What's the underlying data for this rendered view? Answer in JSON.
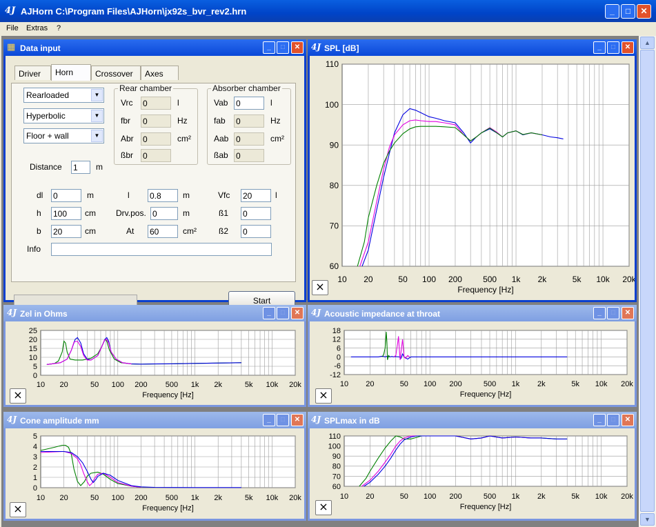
{
  "app": {
    "title": "AJHorn  C:\\Program Files\\AJHorn\\jx92s_bvr_rev2.hrn",
    "icon": "4J"
  },
  "menu": [
    "File",
    "Extras",
    "?"
  ],
  "data_input": {
    "title": "Data input",
    "tabs": [
      "Driver",
      "Horn",
      "Crossover",
      "Axes"
    ],
    "selects": [
      "Rearloaded",
      "Hyperbolic",
      "Floor + wall"
    ],
    "distance": {
      "label": "Distance",
      "value": "1",
      "unit": "m"
    },
    "rear": {
      "title": "Rear chamber",
      "rows": [
        {
          "label": "Vrc",
          "value": "0",
          "unit": "l"
        },
        {
          "label": "fbr",
          "value": "0",
          "unit": "Hz"
        },
        {
          "label": "Abr",
          "value": "0",
          "unit": "cm²"
        },
        {
          "label": "ßbr",
          "value": "0",
          "unit": ""
        }
      ]
    },
    "absorber": {
      "title": "Absorber chamber",
      "rows": [
        {
          "label": "Vab",
          "value": "0",
          "unit": "l"
        },
        {
          "label": "fab",
          "value": "0",
          "unit": "Hz"
        },
        {
          "label": "Aab",
          "value": "0",
          "unit": "cm²"
        },
        {
          "label": "ßab",
          "value": "0",
          "unit": ""
        }
      ]
    },
    "params": [
      {
        "label": "dl",
        "value": "0",
        "unit": "m"
      },
      {
        "label": "l",
        "value": "0.8",
        "unit": "m"
      },
      {
        "label": "Vfc",
        "value": "20",
        "unit": "l"
      },
      {
        "label": "h",
        "value": "100",
        "unit": "cm"
      },
      {
        "label": "Drv.pos.",
        "value": "0",
        "unit": "m"
      },
      {
        "label": "ß1",
        "value": "0",
        "unit": ""
      },
      {
        "label": "b",
        "value": "20",
        "unit": "cm"
      },
      {
        "label": "At",
        "value": "60",
        "unit": "cm²"
      },
      {
        "label": "ß2",
        "value": "0",
        "unit": ""
      }
    ],
    "info_label": "Info",
    "info_value": "",
    "start_label": "Start"
  },
  "close_glyph": "×",
  "charts": [
    {
      "id": "spl",
      "title": "SPL [dB]",
      "xlabel": "Frequency [Hz]",
      "xticks": [
        "10",
        "20",
        "50",
        "100",
        "200",
        "500",
        "1k",
        "2k",
        "5k",
        "10k",
        "20k"
      ],
      "yticks": [
        "110",
        "100",
        "90",
        "80",
        "70",
        "60"
      ],
      "ylim": [
        60,
        110
      ],
      "series": [
        {
          "color": "#0000e0",
          "x": [
            17,
            20,
            25,
            30,
            35,
            40,
            50,
            60,
            70,
            80,
            100,
            120,
            150,
            200,
            250,
            300,
            350,
            400,
            500,
            600,
            700,
            800,
            1000,
            1200,
            1500,
            2000,
            2500,
            3000,
            3500
          ],
          "y": [
            60,
            64,
            74,
            82,
            88,
            93,
            97.5,
            99,
            98.6,
            98,
            97,
            96.6,
            96,
            95.5,
            93,
            90.5,
            92,
            93,
            94,
            93,
            92,
            93,
            93.5,
            92.5,
            93,
            92.5,
            92,
            91.8,
            91.5
          ]
        },
        {
          "color": "#e000e0",
          "x": [
            16,
            20,
            25,
            30,
            35,
            40,
            50,
            60,
            70,
            80,
            100,
            120,
            150,
            200,
            250,
            300,
            350,
            400,
            500,
            600,
            700,
            800,
            1000,
            1200,
            1500,
            2000
          ],
          "y": [
            60,
            66,
            76,
            84,
            89.5,
            92.5,
            95,
            96,
            96.2,
            96,
            95.8,
            95.8,
            95.5,
            95,
            92.5,
            91,
            92,
            93,
            94.3,
            93.2,
            92,
            93,
            93.5,
            92.6,
            93,
            92.5
          ]
        },
        {
          "color": "#008000",
          "x": [
            15,
            18,
            20,
            25,
            30,
            35,
            40,
            50,
            60,
            70,
            80,
            100,
            120,
            150,
            200,
            250,
            300,
            350,
            400,
            500,
            600,
            700,
            800,
            1000,
            1200,
            1500,
            2000
          ],
          "y": [
            60,
            66,
            72,
            80,
            85.5,
            88.5,
            90.5,
            92.8,
            94,
            94.5,
            94.6,
            94.6,
            94.6,
            94.5,
            94.3,
            92.5,
            91,
            92,
            93,
            94.2,
            93,
            92,
            93,
            93.5,
            92.6,
            93,
            92.5
          ]
        }
      ]
    },
    {
      "id": "zel",
      "title": "Zel in Ohms",
      "xlabel": "Frequency [Hz]",
      "xticks": [
        "10",
        "20",
        "50",
        "100",
        "200",
        "500",
        "1k",
        "2k",
        "5k",
        "10k",
        "20k"
      ],
      "yticks": [
        "25",
        "20",
        "15",
        "10",
        "5",
        "0"
      ],
      "ylim": [
        0,
        25
      ],
      "series": [
        {
          "color": "#008000",
          "x": [
            12,
            15,
            17,
            19,
            20,
            21,
            22,
            24,
            28,
            35,
            45,
            55,
            62,
            68,
            72,
            78,
            90,
            110,
            150,
            200,
            300,
            500,
            1000,
            2000,
            4000
          ],
          "y": [
            6,
            6.5,
            8,
            13,
            19,
            18,
            13,
            9,
            8.5,
            8.5,
            9.5,
            12,
            16,
            20,
            19,
            14,
            9,
            7,
            6.3,
            6.2,
            6.3,
            6.4,
            6.6,
            6.8,
            7
          ]
        },
        {
          "color": "#0000e0",
          "x": [
            12,
            15,
            18,
            22,
            25,
            28,
            30,
            33,
            36,
            40,
            45,
            55,
            62,
            68,
            72,
            76,
            82,
            95,
            115,
            150,
            200,
            300,
            500,
            1000,
            2000,
            4000
          ],
          "y": [
            6,
            6.5,
            7,
            9,
            14,
            20,
            21,
            18,
            12,
            9,
            8.5,
            11,
            16,
            20,
            21,
            19,
            13,
            9,
            7,
            6.3,
            6.2,
            6.3,
            6.4,
            6.6,
            6.8,
            7
          ]
        },
        {
          "color": "#e000e0",
          "x": [
            12,
            15,
            18,
            22,
            25,
            27,
            30,
            33,
            36,
            40,
            45,
            55,
            62,
            67,
            71,
            76,
            82,
            95,
            115,
            150
          ],
          "y": [
            6,
            6.5,
            7,
            9,
            14,
            18.5,
            19,
            16,
            11,
            8.5,
            8.5,
            11,
            16,
            19.5,
            20,
            18,
            13,
            9,
            7,
            6.3
          ]
        }
      ]
    },
    {
      "id": "ac",
      "title": "Acoustic impedance at throat",
      "xlabel": "Frequency [Hz]",
      "xticks": [
        "10",
        "20",
        "50",
        "100",
        "200",
        "500",
        "1k",
        "2k",
        "5k",
        "10k",
        "20k"
      ],
      "yticks": [
        "18",
        "12",
        "6",
        "0",
        "-6",
        "-12"
      ],
      "ylim": [
        -12,
        18
      ],
      "series": [
        {
          "color": "#0000e0",
          "x": [
            12,
            20,
            25,
            28,
            30,
            32,
            34,
            36,
            38,
            40,
            44,
            46,
            48,
            50,
            55,
            60,
            80,
            150,
            300,
            1000,
            4000
          ],
          "y": [
            0,
            0,
            0,
            0.5,
            0,
            0.5,
            0,
            0.3,
            0,
            0.2,
            0,
            -1,
            2,
            0,
            -1.5,
            0,
            0,
            0,
            0,
            0,
            0
          ]
        },
        {
          "color": "#008000",
          "x": [
            28,
            29,
            30,
            31,
            31.5,
            32,
            33,
            34
          ],
          "y": [
            0,
            2,
            6,
            17,
            10,
            -2,
            1,
            0
          ]
        },
        {
          "color": "#e000e0",
          "x": [
            38,
            40,
            42,
            43,
            44,
            45,
            46,
            48,
            50,
            52,
            55,
            58
          ],
          "y": [
            0,
            1,
            9,
            14,
            5,
            -2,
            3,
            12,
            0,
            -1,
            1,
            0
          ]
        }
      ]
    },
    {
      "id": "cone",
      "title": "Cone amplitude mm",
      "xlabel": "Frequency [Hz]",
      "xticks": [
        "10",
        "20",
        "50",
        "100",
        "200",
        "500",
        "1k",
        "2k",
        "5k",
        "10k",
        "20k"
      ],
      "yticks": [
        "5",
        "4",
        "3",
        "2",
        "1",
        "0"
      ],
      "ylim": [
        0,
        5
      ],
      "series": [
        {
          "color": "#008000",
          "x": [
            10,
            15,
            19,
            21,
            23,
            25,
            27,
            30,
            33,
            37,
            40,
            45,
            55,
            65,
            80,
            100,
            150,
            200
          ],
          "y": [
            3.6,
            3.9,
            4.1,
            4.1,
            3.9,
            3.2,
            1.8,
            0.6,
            0.2,
            0.6,
            1.1,
            1.4,
            1.5,
            1.3,
            0.8,
            0.4,
            0.15,
            0.05
          ]
        },
        {
          "color": "#e000e0",
          "x": [
            10,
            20,
            25,
            30,
            33,
            36,
            40,
            43,
            46,
            50,
            55,
            65,
            80,
            100,
            150,
            200
          ],
          "y": [
            3.4,
            3.5,
            3.3,
            2.8,
            2.2,
            1.4,
            0.6,
            0.2,
            0.4,
            0.9,
            1.3,
            1.4,
            1,
            0.5,
            0.15,
            0.05
          ]
        },
        {
          "color": "#0000e0",
          "x": [
            10,
            20,
            25,
            30,
            35,
            40,
            45,
            48,
            52,
            55,
            65,
            80,
            100,
            150,
            200,
            300,
            500,
            1000,
            2000,
            4000
          ],
          "y": [
            3.5,
            3.5,
            3.4,
            3,
            2.4,
            1.6,
            0.8,
            0.5,
            0.8,
            1.1,
            1.4,
            1.2,
            0.7,
            0.2,
            0.08,
            0.03,
            0.02,
            0.01,
            0.01,
            0.01
          ]
        }
      ]
    },
    {
      "id": "splmax",
      "title": "SPLmax in dB",
      "xlabel": "Frequency [Hz]",
      "xticks": [
        "10",
        "20",
        "50",
        "100",
        "200",
        "500",
        "1k",
        "2k",
        "5k",
        "10k",
        "20k"
      ],
      "yticks": [
        "110",
        "100",
        "90",
        "80",
        "70",
        "60"
      ],
      "ylim": [
        60,
        110
      ],
      "series": [
        {
          "color": "#008000",
          "x": [
            15,
            18,
            20,
            25,
            30,
            35,
            40,
            45,
            50,
            60,
            80,
            100,
            150,
            200,
            300,
            400,
            500,
            700,
            1000,
            1500,
            2000,
            3000,
            4000
          ],
          "y": [
            60,
            68,
            75,
            88,
            98,
            105,
            110,
            109,
            107,
            107,
            110,
            110,
            110,
            110,
            107,
            108,
            110,
            108,
            109,
            108,
            108,
            107,
            107
          ]
        },
        {
          "color": "#e000e0",
          "x": [
            16,
            20,
            25,
            30,
            35,
            40,
            45,
            50,
            60,
            70,
            80,
            100,
            150,
            200,
            300,
            400,
            500,
            700,
            1000,
            1500,
            2000
          ],
          "y": [
            60,
            66,
            75,
            84,
            92,
            100,
            105,
            108,
            110,
            110,
            110,
            110,
            110,
            110,
            107,
            108,
            110,
            108,
            109,
            108,
            108
          ]
        },
        {
          "color": "#0000e0",
          "x": [
            17,
            20,
            25,
            30,
            35,
            40,
            45,
            50,
            60,
            70,
            80,
            100,
            150,
            200,
            300,
            400,
            500,
            700,
            1000,
            1500,
            2000,
            3000,
            4000
          ],
          "y": [
            60,
            64,
            72,
            80,
            88,
            96,
            102,
            106,
            109,
            110,
            110,
            110,
            110,
            110,
            107,
            108,
            110,
            108,
            109,
            108,
            108,
            107,
            107
          ]
        }
      ]
    }
  ]
}
